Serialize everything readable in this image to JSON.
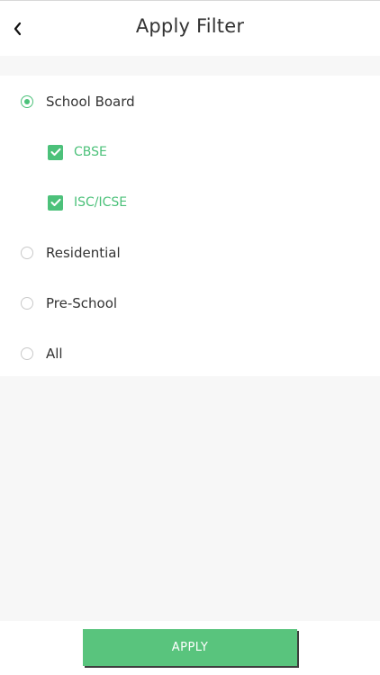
{
  "header": {
    "back_icon": "chevron-left-icon",
    "title": "Apply Filter"
  },
  "filters": {
    "school_board": {
      "label": "School Board",
      "selected": true
    },
    "cbse": {
      "label": "CBSE",
      "checked": true
    },
    "isc_icse": {
      "label": "ISC/ICSE",
      "checked": true
    },
    "residential": {
      "label": "Residential",
      "selected": false
    },
    "pre_school": {
      "label": "Pre-School",
      "selected": false
    },
    "all": {
      "label": "All",
      "selected": false
    }
  },
  "footer": {
    "apply_label": "APPLY"
  },
  "colors": {
    "accent": "#4cc17a",
    "button": "#59c47d",
    "background": "#f7f7f7"
  }
}
